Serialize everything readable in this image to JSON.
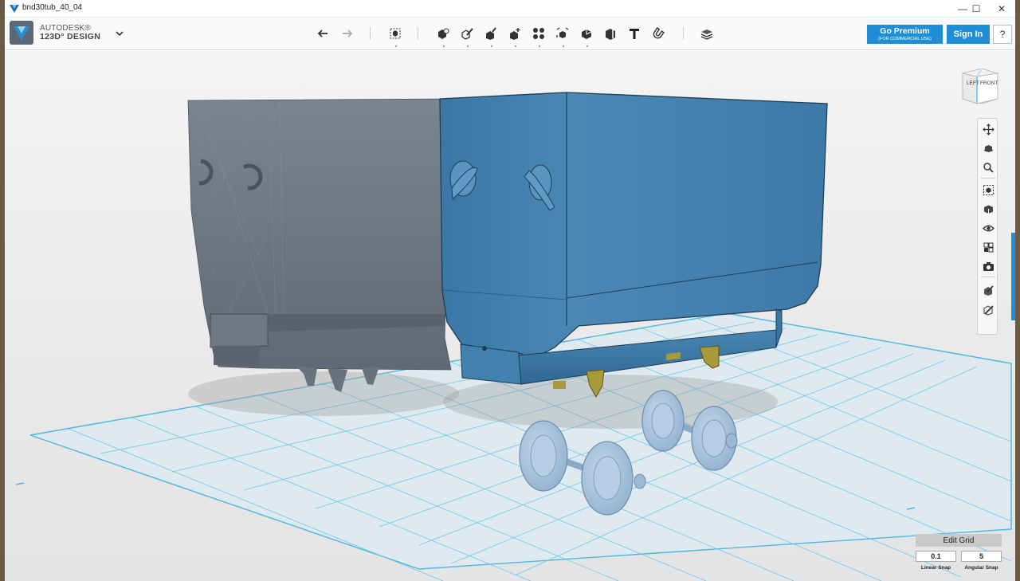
{
  "window": {
    "title": "bnd30tub_40_04",
    "minimize_glyph": "—",
    "maximize_glyph": "☐",
    "close_glyph": "✕"
  },
  "brand": {
    "line1": "AUTODESK®",
    "line2": "123D° DESIGN"
  },
  "toolbar": {
    "tools": [
      "undo-icon",
      "redo-icon",
      "transform-icon",
      "primitives-icon",
      "sketch-icon",
      "construct-icon",
      "modify-icon",
      "pattern-icon",
      "group-icon",
      "combine-icon",
      "measure-icon",
      "text-icon",
      "snap-icon",
      "material-icon"
    ]
  },
  "account": {
    "premium_label": "Go Premium",
    "premium_sub": "(FOR COMMERCIAL USE)",
    "signin_label": "Sign In",
    "help_label": "?"
  },
  "viewcube": {
    "left_label": "LEFT",
    "front_label": "FRONT"
  },
  "navbar": {
    "items": [
      "pan-icon",
      "orbit-icon",
      "zoom-icon",
      "fit-all-icon",
      "view-mode-icon",
      "visibility-icon",
      "materials-outline-icon",
      "screenshot-icon",
      "show-hide-icon",
      "hide-all-icon"
    ]
  },
  "grid": {
    "edit_label": "Edit Grid",
    "linear_snap_value": "0.1",
    "angular_snap_value": "5",
    "linear_snap_label": "Linear Snap",
    "angular_snap_label": "Angular Snap"
  },
  "colors": {
    "accent": "#1e8fd6",
    "model_blue": "#4a86b2",
    "model_gray": "#6f7a86",
    "grid_line": "#5cc0e6",
    "wheel": "#a9c3dc",
    "bracket": "#a89a3a"
  }
}
